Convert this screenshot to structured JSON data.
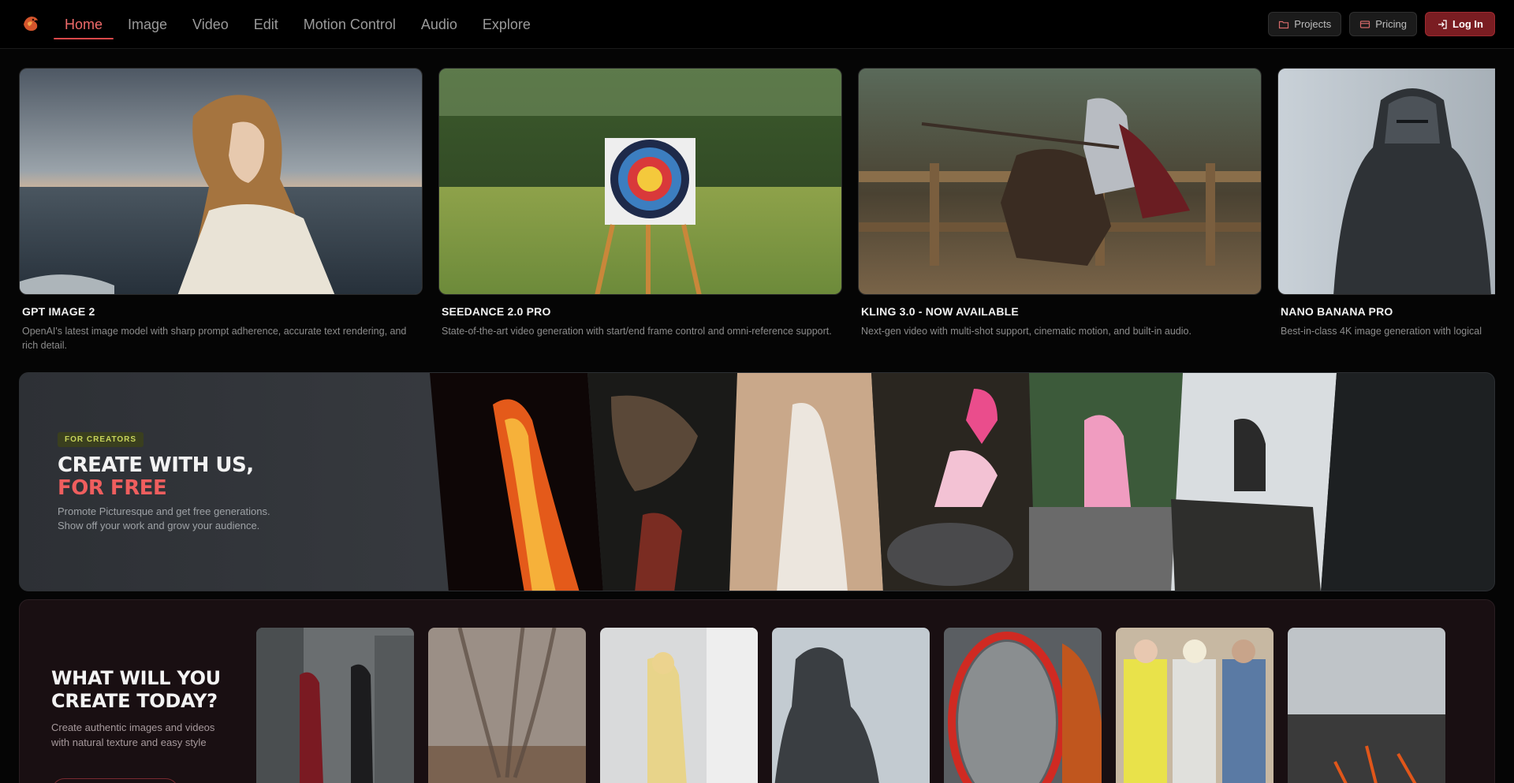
{
  "nav": {
    "links": [
      "Home",
      "Image",
      "Video",
      "Edit",
      "Motion Control",
      "Audio",
      "Explore"
    ],
    "active": "Home",
    "projects": "Projects",
    "pricing": "Pricing",
    "login": "Log In"
  },
  "cards": [
    {
      "title": "GPT IMAGE 2",
      "desc": "OpenAI's latest image model with sharp prompt adherence, accurate text rendering, and rich detail."
    },
    {
      "title": "SEEDANCE 2.0 PRO",
      "desc": "State-of-the-art video generation with start/end frame control and omni-reference support."
    },
    {
      "title": "KLING 3.0 - NOW AVAILABLE",
      "desc": "Next-gen video with multi-shot support, cinematic motion, and built-in audio."
    },
    {
      "title": "NANO BANANA PRO",
      "desc": "Best-in-class 4K image generation with logical"
    }
  ],
  "creators": {
    "badge": "FOR CREATORS",
    "title_line1": "CREATE WITH US,",
    "title_line2": "FOR FREE",
    "desc": "Promote Picturesque and get free generations. Show off your work and grow your audience."
  },
  "today": {
    "title": "WHAT WILL YOU CREATE TODAY?",
    "desc": "Create authentic images and videos with natural texture and easy style"
  },
  "colors": {
    "accent": "#ef5e5e",
    "brand": "#7a1d22",
    "badge": "#c8d45a"
  }
}
